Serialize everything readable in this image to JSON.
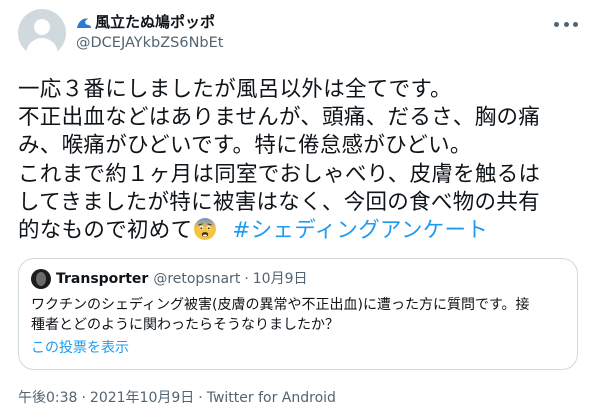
{
  "author": {
    "display_name": "風立たぬ鳩ポッポ",
    "handle": "@DCEJAYkbZS6NbEt",
    "avatar_icon": "default-profile-icon",
    "name_emoji_icon": "water-wave-icon"
  },
  "tweet": {
    "lines": [
      "一応３番にしましたが風呂以外は全てです。",
      "不正出血などはありませんが、頭痛、だるさ、胸の痛",
      "み、喉痛がひどいです。特に倦怠感がひどい。",
      "これまで約１ヶ月は同室でおしゃべり、皮膚を触るは",
      "してきましたが特に被害はなく、今回の食べ物の共有"
    ],
    "last_line": "的なもので初めて",
    "emoji_icon": "fearful-face-emoji-icon",
    "hashtag": "#シェディングアンケート"
  },
  "quoted": {
    "name": "Transporter",
    "handle": "@retopsnart",
    "separator": "·",
    "date": "10月9日",
    "text_line1": "ワクチンのシェディング被害(皮膚の異常や不正出血)に遭った方に質問です。接",
    "text_line2": "種者とどのように関わったらそうなりましたか？",
    "link_label": "この投票を表示"
  },
  "meta": {
    "time": "午後0:38",
    "separator": "·",
    "date": "2021年10月9日",
    "source": "Twitter for Android"
  },
  "colors": {
    "text": "#0f1419",
    "secondary": "#536471",
    "link": "#1d9bf0",
    "border": "#cfd9de"
  }
}
